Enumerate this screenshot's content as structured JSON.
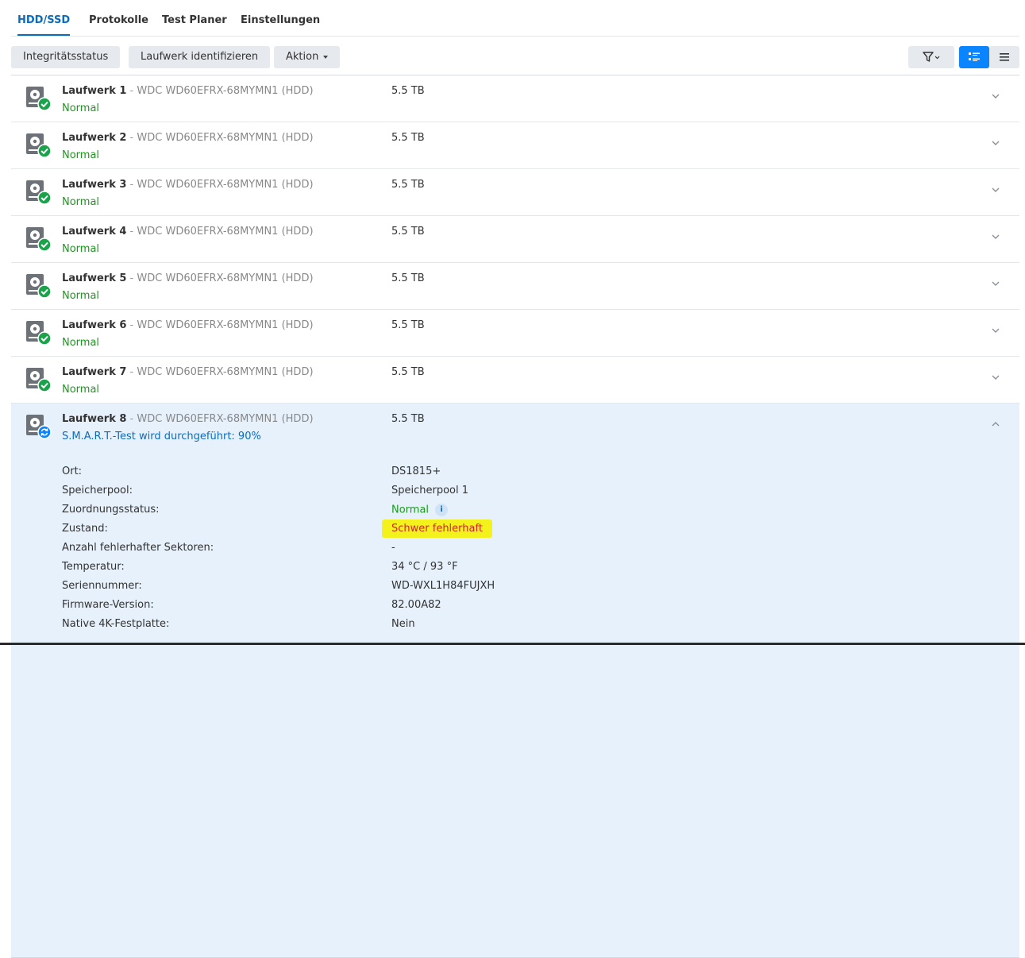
{
  "tabs": [
    "HDD/SSD",
    "Protokolle",
    "Test Planer",
    "Einstellungen"
  ],
  "toolbar": {
    "integrity_label": "Integritätsstatus",
    "identify_label": "Laufwerk identifizieren",
    "action_label": "Aktion"
  },
  "drives": [
    {
      "name": "Laufwerk 1",
      "sep": " - ",
      "model": "WDC WD60EFRX-68MYMN1 (HDD)",
      "size": "5.5 TB",
      "status": "Normal"
    },
    {
      "name": "Laufwerk 2",
      "sep": " - ",
      "model": "WDC WD60EFRX-68MYMN1 (HDD)",
      "size": "5.5 TB",
      "status": "Normal"
    },
    {
      "name": "Laufwerk 3",
      "sep": " - ",
      "model": "WDC WD60EFRX-68MYMN1 (HDD)",
      "size": "5.5 TB",
      "status": "Normal"
    },
    {
      "name": "Laufwerk 4",
      "sep": " - ",
      "model": "WDC WD60EFRX-68MYMN1 (HDD)",
      "size": "5.5 TB",
      "status": "Normal"
    },
    {
      "name": "Laufwerk 5",
      "sep": " - ",
      "model": "WDC WD60EFRX-68MYMN1 (HDD)",
      "size": "5.5 TB",
      "status": "Normal"
    },
    {
      "name": "Laufwerk 6",
      "sep": " - ",
      "model": "WDC WD60EFRX-68MYMN1 (HDD)",
      "size": "5.5 TB",
      "status": "Normal"
    },
    {
      "name": "Laufwerk 7",
      "sep": " - ",
      "model": "WDC WD60EFRX-68MYMN1 (HDD)",
      "size": "5.5 TB",
      "status": "Normal"
    },
    {
      "name": "Laufwerk 8",
      "sep": " - ",
      "model": "WDC WD60EFRX-68MYMN1 (HDD)",
      "size": "5.5 TB",
      "status": "S.M.A.R.T.-Test wird durchgeführt: 90%"
    }
  ],
  "details": [
    {
      "label": "Ort:",
      "value": "DS1815+"
    },
    {
      "label": "Speicherpool:",
      "value": "Speicherpool 1"
    },
    {
      "label": "Zuordnungsstatus:",
      "value": "Normal"
    },
    {
      "label": "Zustand:",
      "value": "Schwer fehlerhaft"
    },
    {
      "label": "Anzahl fehlerhafter Sektoren:",
      "value": "-"
    },
    {
      "label": "Temperatur:",
      "value": "34 °C / 93 °F"
    },
    {
      "label": "Seriennummer:",
      "value": "WD-WXL1H84FUJXH"
    },
    {
      "label": "Firmware-Version:",
      "value": "82.00A82"
    },
    {
      "label": "Native 4K-Festplatte:",
      "value": "Nein"
    }
  ],
  "colors": {
    "accent": "#0a6cbd",
    "ok": "#1a9a1a",
    "bad": "#d3262c",
    "highlight": "#f4f21d",
    "expanded_bg": "#e6f1fc"
  }
}
